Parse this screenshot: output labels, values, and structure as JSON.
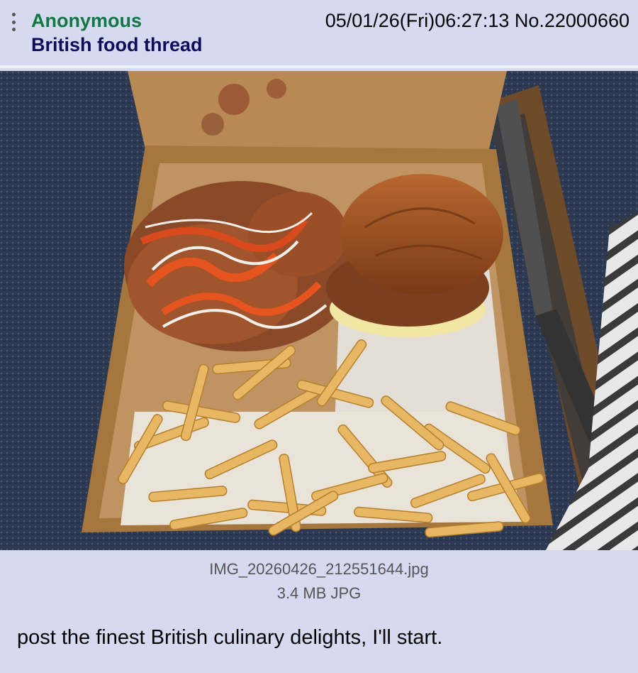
{
  "post": {
    "name": "Anonymous",
    "subject": "British food thread",
    "meta": "05/01/26(Fri)06:27:13 No.22000660",
    "file": {
      "name": "IMG_20260426_212551644.jpg",
      "size": "3.4 MB JPG"
    },
    "comment": "post the finest British culinary delights, I'll start."
  },
  "icons": {
    "menu": "vertical-ellipsis-icon"
  },
  "colors": {
    "background": "#d6daf0",
    "name": "#117743",
    "subject": "#0f0c5d"
  }
}
